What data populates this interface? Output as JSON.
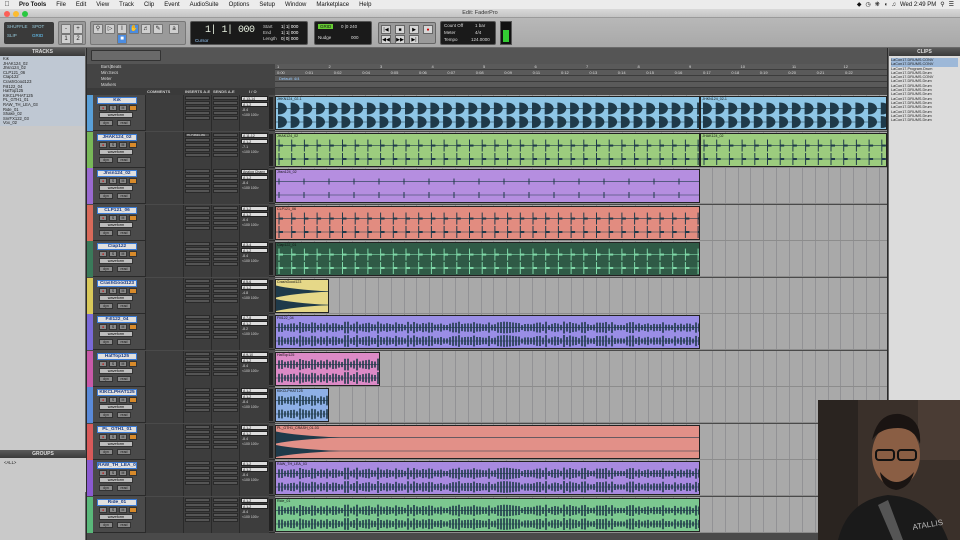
{
  "menubar": {
    "apple": "",
    "menus": [
      "Pro Tools",
      "File",
      "Edit",
      "View",
      "Track",
      "Clip",
      "Event",
      "AudioSuite",
      "Options",
      "Setup",
      "Window",
      "Marketplace",
      "Help"
    ],
    "clock": "Wed 2:49 PM"
  },
  "window": {
    "title": "Edit: FaderPro"
  },
  "toolbar": {
    "mode_shuffle": "SHUFFLE",
    "mode_spot": "SPOT",
    "mode_slip": "SLIP",
    "mode_grid": "GRID",
    "counter_main": "1| 1| 000",
    "counter_sub": "Cursor",
    "start_label": "Start",
    "end_label": "End",
    "length_label": "Length",
    "start_val": "1| 1| 000",
    "end_val": "1| 1| 000",
    "length_val": "0| 0| 000",
    "grid_val": "0 |0 240",
    "nudge_label": "Nudge",
    "nudge_val": "000",
    "count_off": "Count Off",
    "meter_label": "Meter",
    "tempo_label": "Tempo",
    "meter_val": "4/4",
    "tempo_val": "124.0000",
    "bar_val": "1 bar"
  },
  "left_pane": {
    "tracks_header": "TRACKS",
    "tracks": [
      "Kik",
      "JHAK124_02",
      "Jhsn124_02",
      "CLP121_06",
      "Clap122",
      "CrashGood123",
      "Fill122_04",
      "HatTop125",
      "KIKCLPHAT125",
      "PL_GTH1_01",
      "RAW_TH_LEA_03",
      "Ride_01",
      "Shake_02",
      "SnrFX122_03",
      "Vox_02"
    ],
    "groups_header": "GROUPS",
    "groups": [
      "<ALL>"
    ]
  },
  "clips_pane": {
    "header": "CLIPS",
    "items": [
      "LaCon17.DRUMS.CONV",
      "LaCon17.DRUMS.CONV",
      "LaCon17.Program.Drum",
      "LaCon17.DRUMS.Drum",
      "LaCon17.DRUMS.CONV",
      "LaCon17.DRUMS.Drum",
      "LaCon17.DRUMS.Drum",
      "LaCon17.DRUMS.Drum",
      "LaCon17.DRUMS.Drum",
      "LaCon17.DRUMS.Drum",
      "LaCon17.DRUMS.Drum",
      "LaCon17.DRUMS.Drum",
      "LaCon17.DRUMS.Drum",
      "LaCon17.DRUMS.Drum",
      "LaCon17.DRUMS.Drum"
    ]
  },
  "ruler": {
    "labels": [
      "Bars|Beats",
      "Min:Secs",
      "Meter",
      "Markers"
    ],
    "bars": [
      "1",
      "2",
      "3",
      "4",
      "5",
      "6",
      "7",
      "8",
      "9",
      "10",
      "11",
      "12"
    ],
    "secs": [
      "0:00",
      "0:01",
      "0:02",
      "0:04",
      "0:05",
      "0:06",
      "0:07",
      "0:08",
      "0:09",
      "0:11",
      "0:12",
      "0:13",
      "0:14",
      "0:15",
      "0:16",
      "0:17",
      "0:18",
      "0:19",
      "0:20",
      "0:21",
      "0:22"
    ],
    "meter_marker": "Default: 4/4"
  },
  "columns": [
    "COMMENTS",
    "INSERTS A-E",
    "SENDS A-E",
    "I / O"
  ],
  "track_view_label": "waveform",
  "track_btns": {
    "rec": "●",
    "solo": "S",
    "mute": "M",
    "dyn": "dyn",
    "read": "read"
  },
  "tracks": [
    {
      "name": "Kik",
      "color": "#5aa0d8",
      "clip_color": "#8ec6e6",
      "io_in": "A 13-14",
      "io_out": "A 1-2",
      "vol": "-8.4",
      "pan": "<100 100>",
      "insert": "",
      "clips": [
        {
          "name": "JHKN124_02-1",
          "start": 0,
          "end": 0.695
        },
        {
          "name": "JHKN124_02-1",
          "start": 0.695,
          "end": 1.0
        }
      ],
      "wave": "kick"
    },
    {
      "name": "JHAK124_02",
      "color": "#78b858",
      "clip_color": "#9ccc7e",
      "io_in": "A 11-12",
      "io_out": "A 1-2",
      "vol": "-7.1",
      "pan": "<100 100>",
      "insert": "Hi-Pass/Low",
      "clips": [
        {
          "name": "JHAK124_02",
          "start": 0,
          "end": 0.695
        },
        {
          "name": "JHAK124_02",
          "start": 0.695,
          "end": 1.0
        }
      ],
      "wave": "sparse"
    },
    {
      "name": "Jhsn124_02",
      "color": "#9a6ad0",
      "clip_color": "#b58ee0",
      "io_in": "Analog Chann",
      "io_out": "A 1-2",
      "vol": "-8.4",
      "pan": "<100 100>",
      "insert": "",
      "clips": [
        {
          "name": "Jhsn124_02",
          "start": 0,
          "end": 0.695
        }
      ],
      "wave": "ticks"
    },
    {
      "name": "CLP121_06",
      "color": "#d86a5a",
      "clip_color": "#e28c80",
      "io_in": "A 1-2",
      "io_out": "A 1-2",
      "vol": "-6.4",
      "pan": "<100 100>",
      "insert": "",
      "clips": [
        {
          "name": "CLP121_06",
          "start": 0,
          "end": 0.695
        }
      ],
      "wave": "sparse"
    },
    {
      "name": "Clap122",
      "color": "#3a7a5a",
      "clip_color": "#2f5a46",
      "io_in": "A 3-4",
      "io_out": "A 1-2",
      "vol": "-8.4",
      "pan": "<100 100>",
      "insert": "",
      "clips": [
        {
          "name": "Clap122_01",
          "start": 0,
          "end": 0.695
        }
      ],
      "wave": "clap"
    },
    {
      "name": "CrashGood123",
      "color": "#d8c85a",
      "clip_color": "#e6d888",
      "io_in": "A 5-6",
      "io_out": "A 1-2",
      "vol": "-4.8",
      "pan": "<100 100>",
      "insert": "",
      "clips": [
        {
          "name": "CrashGood123",
          "start": 0,
          "end": 0.088
        }
      ],
      "wave": "crash"
    },
    {
      "name": "Fill122_04",
      "color": "#7a6ad8",
      "clip_color": "#9a8ee6",
      "io_in": "A 7-8",
      "io_out": "A 1-2",
      "vol": "-8.2",
      "pan": "<100 100>",
      "insert": "",
      "clips": [
        {
          "name": "Fill122_04",
          "start": 0,
          "end": 0.695
        }
      ],
      "wave": "dense"
    },
    {
      "name": "HatTop125",
      "color": "#c85aa8",
      "clip_color": "#dc8ac6",
      "io_in": "A 9-10",
      "io_out": "A 1-2",
      "vol": "-8.4",
      "pan": "<100 100>",
      "insert": "",
      "clips": [
        {
          "name": "HatTop125",
          "start": 0,
          "end": 0.172
        }
      ],
      "wave": "dense"
    },
    {
      "name": "KIKCLPHAT125",
      "color": "#5a8ad8",
      "clip_color": "#8eb0e6",
      "io_in": "A 1-2",
      "io_out": "A 1-2",
      "vol": "-8.4",
      "pan": "<100 100>",
      "insert": "",
      "clips": [
        {
          "name": "KIKCLPHAT125",
          "start": 0,
          "end": 0.088
        }
      ],
      "wave": "dense"
    },
    {
      "name": "PL_GTH1_01",
      "color": "#d85a5a",
      "clip_color": "#e29088",
      "io_in": "A 1-2",
      "io_out": "A 1-2",
      "vol": "-8.4",
      "pan": "<100 100>",
      "insert": "",
      "clips": [
        {
          "name": "PL_GTH1_CRASH_01-03",
          "start": 0,
          "end": 0.695
        }
      ],
      "wave": "crashlong"
    },
    {
      "name": "RAW_TH_LEA_03",
      "color": "#8a5ad0",
      "clip_color": "#a88ae0",
      "io_in": "A 1-2",
      "io_out": "A 1-2",
      "vol": "-8.4",
      "pan": "<100 100>",
      "insert": "",
      "clips": [
        {
          "name": "RAW_TH_LEA_03",
          "start": 0,
          "end": 0.695
        }
      ],
      "wave": "dense"
    },
    {
      "name": "Ride_01",
      "color": "#5ab87a",
      "clip_color": "#7cc890",
      "io_in": "A 1-2",
      "io_out": "A 1-2",
      "vol": "-8.4",
      "pan": "<100 100>",
      "insert": "",
      "clips": [
        {
          "name": "Ride_01",
          "start": 0,
          "end": 0.695
        }
      ],
      "wave": "dense"
    }
  ]
}
